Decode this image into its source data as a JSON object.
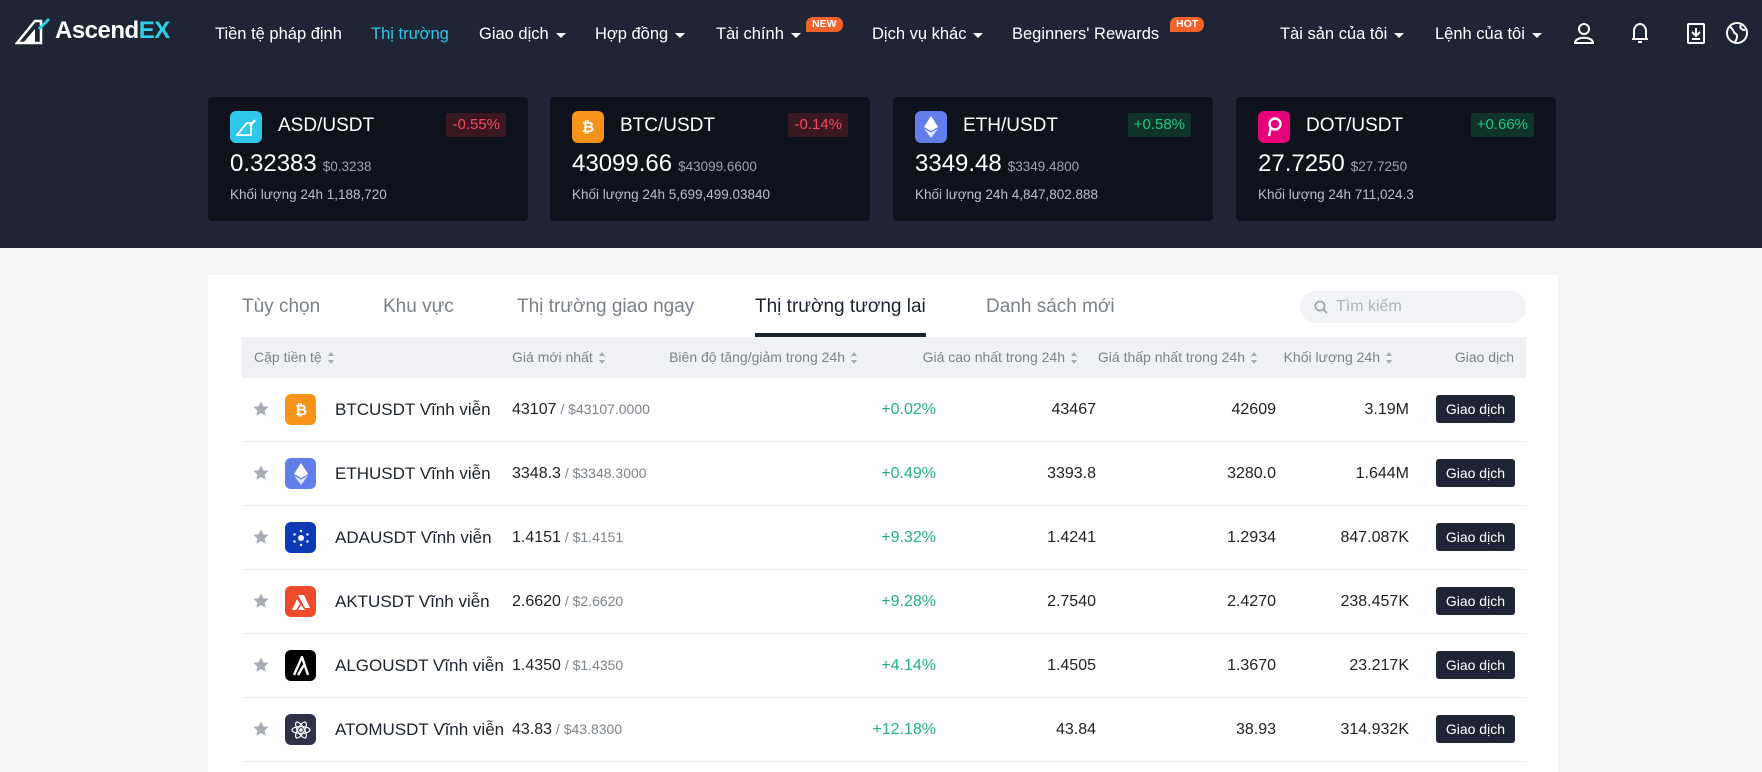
{
  "nav": {
    "logo_main": "Ascend",
    "logo_accent": "EX",
    "items": [
      {
        "label": "Tiền tệ pháp định"
      },
      {
        "label": "Thị trường"
      },
      {
        "label": "Giao dịch"
      },
      {
        "label": "Hợp đồng"
      },
      {
        "label": "Tài chính",
        "badge": "NEW"
      },
      {
        "label": "Dịch vụ khác"
      },
      {
        "label": "Beginners' Rewards",
        "badge": "HOT"
      },
      {
        "label": "Tài sản của tôi"
      },
      {
        "label": "Lệnh của tôi"
      }
    ],
    "icons": [
      "user-icon",
      "bell-icon",
      "download-icon",
      "globe-icon"
    ]
  },
  "tickers": [
    {
      "pair": "ASD/USDT",
      "change": "-0.55%",
      "price": "0.32383",
      "usd": "$0.3238",
      "volume": "Khối lượng 24h 1,188,720",
      "icon": "asd-coin-icon",
      "color": "#2ec9e8"
    },
    {
      "pair": "BTC/USDT",
      "change": "-0.14%",
      "price": "43099.66",
      "usd": "$43099.6600",
      "volume": "Khối lượng 24h 5,699,499.03840",
      "icon": "btc-coin-icon",
      "color": "#f7931a"
    },
    {
      "pair": "ETH/USDT",
      "change": "+0.58%",
      "price": "3349.48",
      "usd": "$3349.4800",
      "volume": "Khối lượng 24h 4,847,802.888",
      "icon": "eth-coin-icon",
      "color": "#627eea"
    },
    {
      "pair": "DOT/USDT",
      "change": "+0.66%",
      "price": "27.7250",
      "usd": "$27.7250",
      "volume": "Khối lượng 24h 711,024.3",
      "icon": "dot-coin-icon",
      "color": "#e6007a"
    }
  ],
  "tabs": [
    "Tùy chọn",
    "Khu vực",
    "Thị trường giao ngay",
    "Thị trường tương lai",
    "Danh sách mới"
  ],
  "active_tab": "Thị trường tương lai",
  "search": {
    "placeholder": "Tìm kiếm",
    "value": ""
  },
  "table": {
    "headers": [
      "Cặp tiền tệ",
      "Giá mới nhất",
      "Biên độ tăng/giảm trong 24h",
      "Giá cao nhất trong 24h",
      "Giá thấp nhất trong 24h",
      "Khối lượng 24h",
      "Giao dịch"
    ],
    "rows": [
      {
        "symbol": "BTCUSDT Vĩnh viễn",
        "last": "43107",
        "last_usd": " / $43107.0000",
        "change": "+0.02%",
        "high": "43467",
        "low": "42609",
        "volume": "3.19M",
        "action": "Giao dịch",
        "icon": "btc-coin-icon",
        "color": "#f7931a"
      },
      {
        "symbol": "ETHUSDT Vĩnh viễn",
        "last": "3348.3",
        "last_usd": " / $3348.3000",
        "change": "+0.49%",
        "high": "3393.8",
        "low": "3280.0",
        "volume": "1.644M",
        "action": "Giao dịch",
        "icon": "eth-coin-icon",
        "color": "#627eea"
      },
      {
        "symbol": "ADAUSDT Vĩnh viễn",
        "last": "1.4151",
        "last_usd": " / $1.4151",
        "change": "+9.32%",
        "high": "1.4241",
        "low": "1.2934",
        "volume": "847.087K",
        "action": "Giao dịch",
        "icon": "ada-coin-icon",
        "color": "#0d3bb8"
      },
      {
        "symbol": "AKTUSDT Vĩnh viễn",
        "last": "2.6620",
        "last_usd": " / $2.6620",
        "change": "+9.28%",
        "high": "2.7540",
        "low": "2.4270",
        "volume": "238.457K",
        "action": "Giao dịch",
        "icon": "akt-coin-icon",
        "color": "#ef4a2c"
      },
      {
        "symbol": "ALGOUSDT Vĩnh viễn",
        "last": "1.4350",
        "last_usd": " / $1.4350",
        "change": "+4.14%",
        "high": "1.4505",
        "low": "1.3670",
        "volume": "23.217K",
        "action": "Giao dịch",
        "icon": "algo-coin-icon",
        "color": "#000000"
      },
      {
        "symbol": "ATOMUSDT Vĩnh viễn",
        "last": "43.83",
        "last_usd": " / $43.8300",
        "change": "+12.18%",
        "high": "43.84",
        "low": "38.93",
        "volume": "314.932K",
        "action": "Giao dịch",
        "icon": "atom-coin-icon",
        "color": "#2e3148"
      }
    ]
  }
}
